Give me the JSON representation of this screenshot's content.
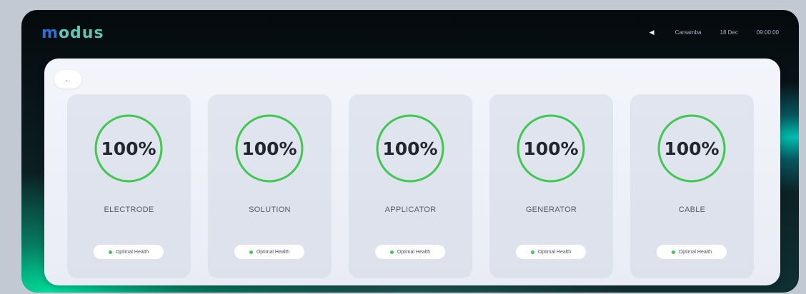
{
  "app": {
    "logo_prefix": "m",
    "logo_rest": "odus",
    "logo_prefix_color": "#2e6fd1",
    "logo_rest_color": "#5ec6b4"
  },
  "status_bar": {
    "icon": "speaker-icon",
    "day": "Carsamba",
    "date": "18 Dec",
    "time": "09:00:00"
  },
  "back_button": {
    "icon": "arrow-left-icon",
    "glyph": "←"
  },
  "colors": {
    "ring": "#3ec94f",
    "status_ok": "#3ec94f"
  },
  "components": [
    {
      "name": "ELECTRODE",
      "health_pct": 100,
      "value_label": "100%",
      "status": "Optimal Health"
    },
    {
      "name": "SOLUTION",
      "health_pct": 100,
      "value_label": "100%",
      "status": "Optimal Health"
    },
    {
      "name": "APPLICATOR",
      "health_pct": 100,
      "value_label": "100%",
      "status": "Optimal Health"
    },
    {
      "name": "GENERATOR",
      "health_pct": 100,
      "value_label": "100%",
      "status": "Optimal Health"
    },
    {
      "name": "CABLE",
      "health_pct": 100,
      "value_label": "100%",
      "status": "Optimal Health"
    }
  ]
}
